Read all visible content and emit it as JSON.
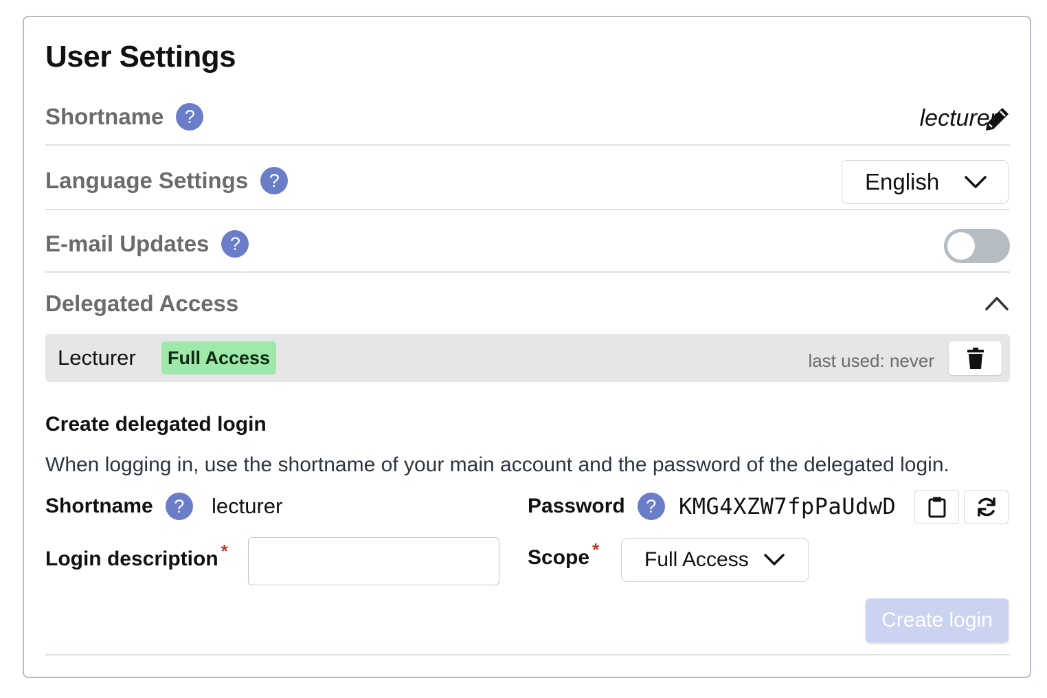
{
  "title": "User Settings",
  "shortname": {
    "label": "Shortname",
    "value": "lecturer"
  },
  "language": {
    "label": "Language Settings",
    "selected": "English"
  },
  "email_updates": {
    "label": "E-mail Updates",
    "enabled": false
  },
  "delegated_access": {
    "label": "Delegated Access",
    "expanded": true,
    "entries": [
      {
        "name": "Lecturer",
        "scope_badge": "Full Access",
        "last_used": "last used: never"
      }
    ]
  },
  "create_form": {
    "title": "Create delegated login",
    "description": "When logging in, use the shortname of your main account and the password of the delegated login.",
    "shortname_label": "Shortname",
    "shortname_value": "lecturer",
    "password_label": "Password",
    "password_value": "KMG4XZW7fpPaUdwD",
    "login_description_label": "Login description",
    "login_description_value": "",
    "required_mark": "*",
    "scope_label": "Scope",
    "scope_selected": "Full Access",
    "create_button": "Create login"
  },
  "help_glyph": "?",
  "colors": {
    "help_badge": "#6a7dc9",
    "full_access_badge": "#9ee8a9",
    "toggle_off": "#b5bcc3",
    "create_button_disabled": "#ccd3f0"
  },
  "icons": {
    "edit": "pencil-icon",
    "dropdown": "chevron-down-icon",
    "collapse": "chevron-up-icon",
    "delete": "trash-icon",
    "copy": "clipboard-icon",
    "regenerate": "refresh-icon",
    "help": "question-icon"
  }
}
